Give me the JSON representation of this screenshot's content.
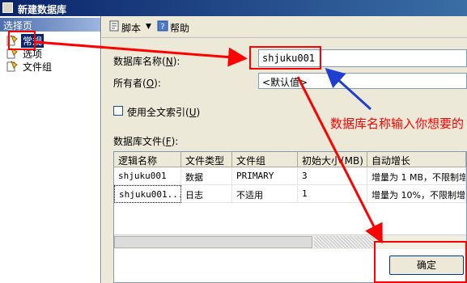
{
  "window": {
    "title": "新建数据库"
  },
  "left_panel": {
    "header": "选择页",
    "items": [
      {
        "label": "常规",
        "selected": true
      },
      {
        "label": "选项",
        "selected": false
      },
      {
        "label": "文件组",
        "selected": false
      }
    ]
  },
  "toolbar": {
    "script_label": "脚本",
    "help_label": "帮助"
  },
  "form": {
    "db_name_label": "数据库名称",
    "db_name_key": "N",
    "db_name_value": "shjuku001",
    "owner_label": "所有者",
    "owner_key": "O",
    "owner_value": "<默认值>",
    "fulltext_label": "使用全文索引",
    "fulltext_key": "U",
    "files_label": "数据库文件",
    "files_key": "F"
  },
  "files_table": {
    "columns": [
      "逻辑名称",
      "文件类型",
      "文件组",
      "初始大小(MB)",
      "自动增长"
    ],
    "rows": [
      [
        "shjuku001",
        "数据",
        "PRIMARY",
        "3",
        "增量为 1 MB，不限制增"
      ],
      [
        "shjuku001...",
        "日志",
        "不适用",
        "1",
        "增量为 10%，不限制增"
      ]
    ]
  },
  "ok_label": "确定",
  "annotation": {
    "text": "数据库名称输入你想要的",
    "color": "#ff0000"
  },
  "colors": {
    "title_bar": "#0a246a",
    "annotation_red": "#ff0000",
    "arrow_blue": "#1f3fd0"
  }
}
